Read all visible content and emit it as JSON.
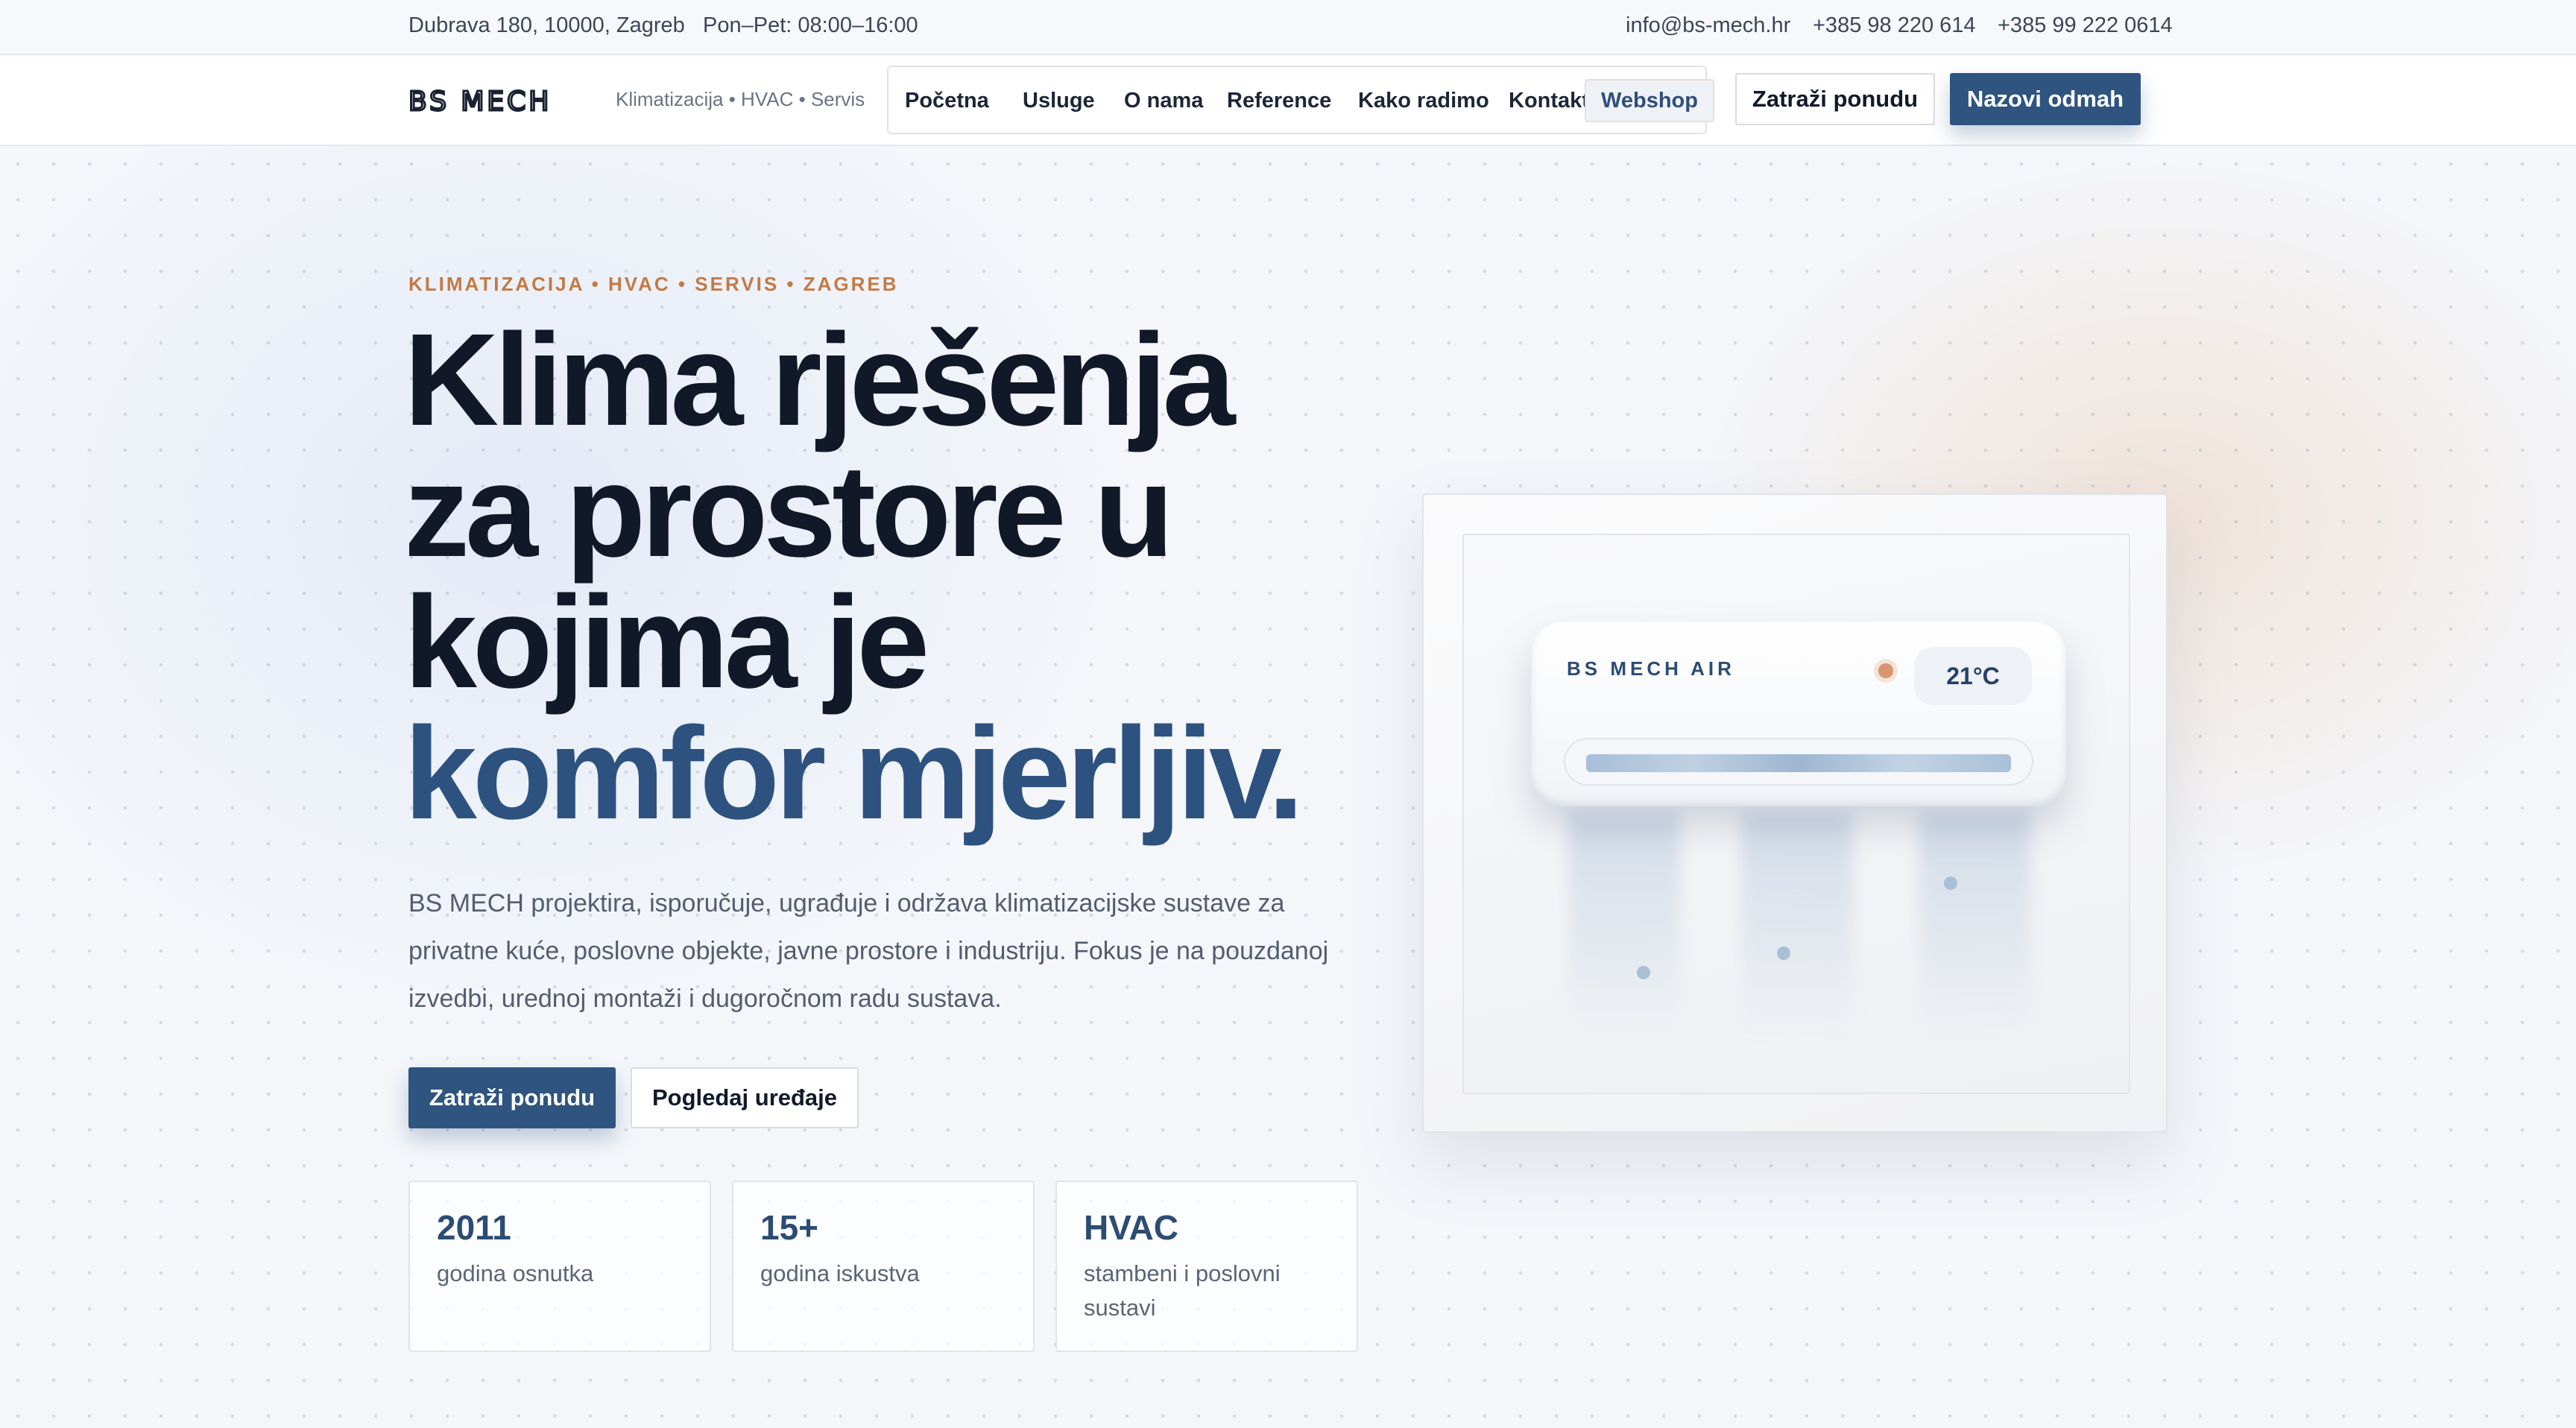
{
  "topbar": {
    "address": "Dubrava 180, 10000, Zagreb",
    "hours": "Pon–Pet: 08:00–16:00",
    "email": "info@bs-mech.hr",
    "phone1": "+385 98 220 614",
    "phone2": "+385 99 222 0614"
  },
  "nav": {
    "logo": "BS MECH",
    "tagline": "Klimatizacija • HVAC • Servis",
    "links": [
      "Početna",
      "Usluge",
      "O nama",
      "Reference",
      "Kako radimo",
      "Kontakt",
      "Webshop"
    ],
    "active_link": "Webshop",
    "quote_button": "Zatraži ponudu",
    "call_button": "Nazovi odmah"
  },
  "hero": {
    "eyebrow": "KLIMATIZACIJA • HVAC • SERVIS • ZAGREB",
    "headline": [
      "Klima rješenja",
      "za prostore u",
      "kojima je",
      "komfor mjerljiv."
    ],
    "lede": "BS MECH projektira, isporučuje, ugrađuje i održava klimatizacijske sustave za privatne kuće, poslovne objekte, javne prostore i industriju. Fokus je na pouzdanoj izvedbi, urednoj montaži i dugoročnom radu sustava.",
    "primary_button": "Zatraži ponudu",
    "secondary_button": "Pogledaj uređaje",
    "stats": [
      {
        "value": "2011",
        "label": "godina osnutka"
      },
      {
        "value": "15+",
        "label": "godina iskustva"
      },
      {
        "value": "HVAC",
        "label": "stambeni i poslovni sustavi"
      }
    ]
  },
  "illustration": {
    "ac_brand": "BS MECH AIR",
    "temperature": "21°C"
  },
  "colors": {
    "accent": "#2f5480",
    "eyebrow": "#c27a45",
    "text_dark": "#111827"
  }
}
